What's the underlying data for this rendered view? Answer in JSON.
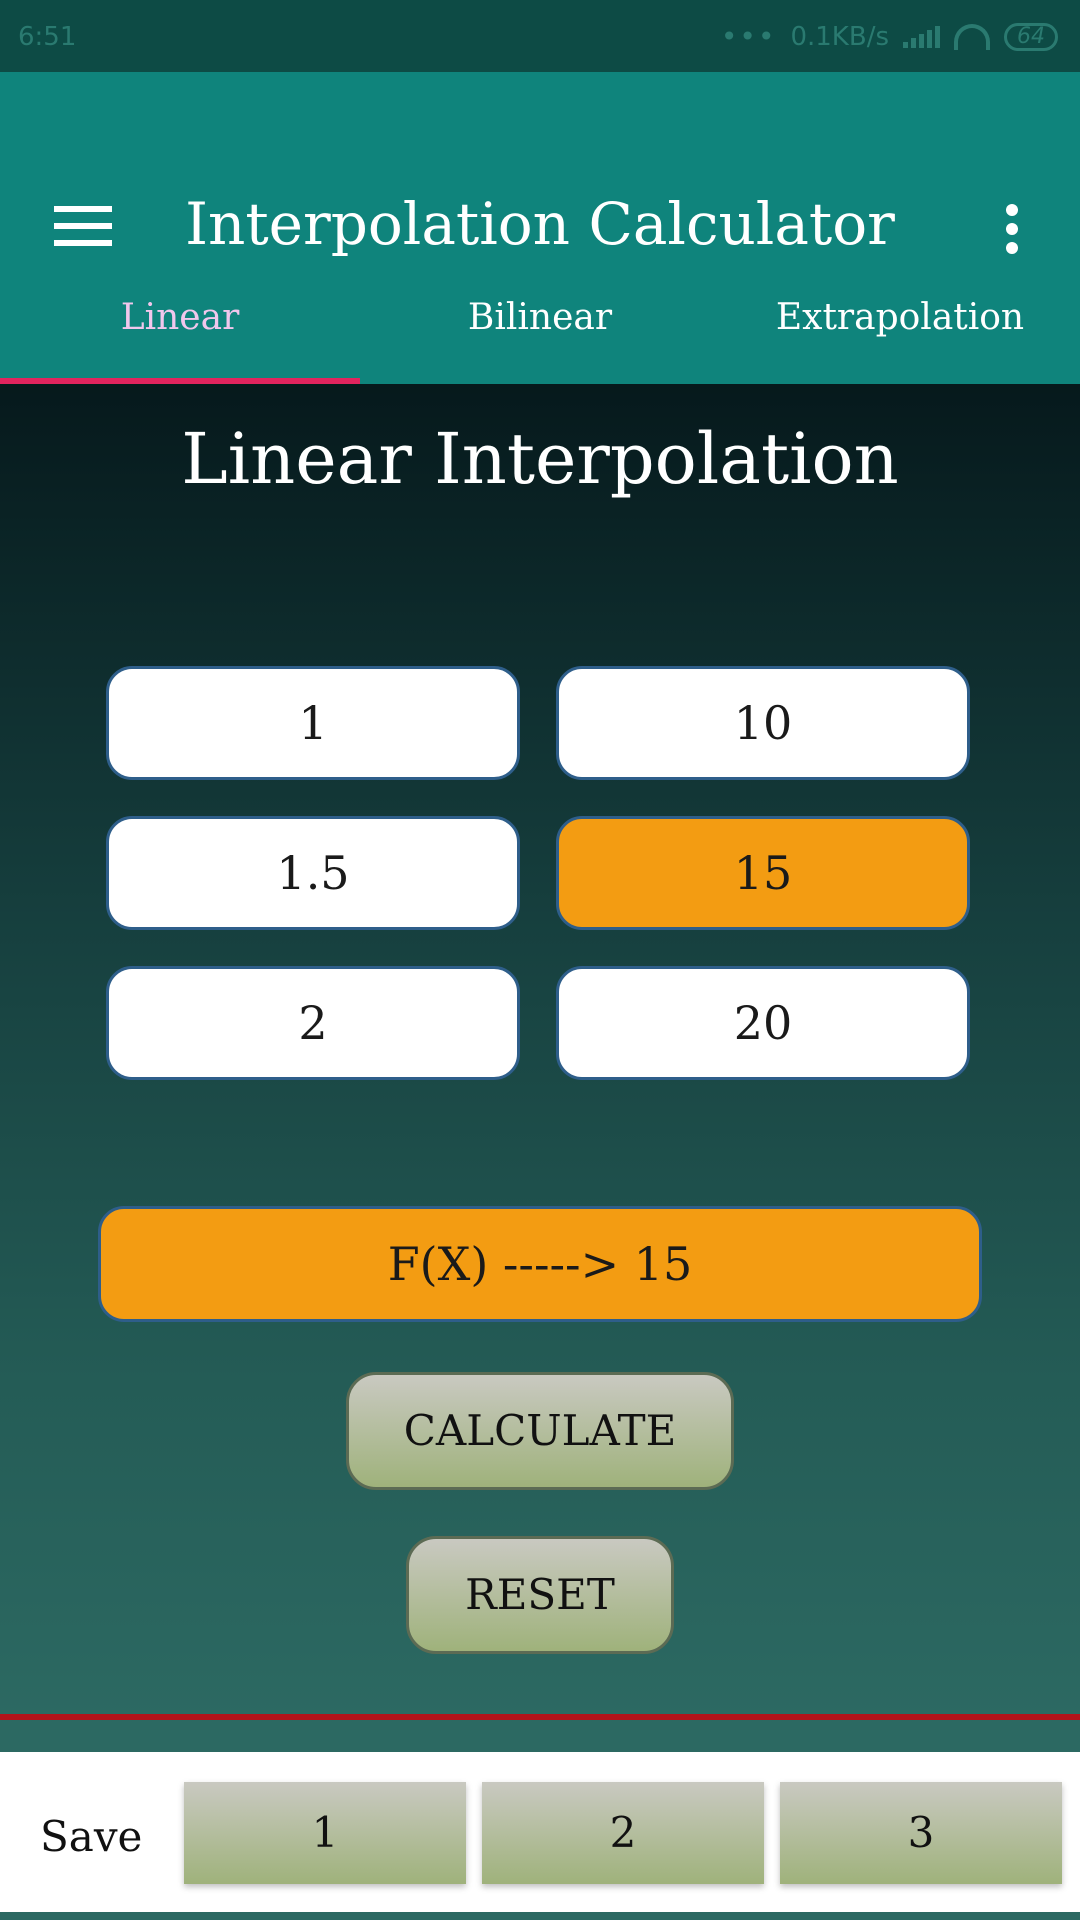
{
  "status_bar": {
    "time": "6:51",
    "network_speed": "0.1KB/s",
    "battery": "64"
  },
  "app_bar": {
    "title": "Interpolation Calculator",
    "menu_icon": "hamburger-menu-icon",
    "more_icon": "more-vertical-icon"
  },
  "tabs": [
    {
      "label": "Linear",
      "active": true
    },
    {
      "label": "Bilinear",
      "active": false
    },
    {
      "label": "Extrapolation",
      "active": false
    }
  ],
  "main": {
    "heading": "Linear Interpolation",
    "x1": "1",
    "y1": "10",
    "x": "1.5",
    "y": "15",
    "x2": "2",
    "y2": "20",
    "result": "F(X) ----->  15",
    "calculate_label": "CALCULATE",
    "reset_label": "RESET"
  },
  "save_bar": {
    "label": "Save",
    "slots": [
      "1",
      "2",
      "3"
    ]
  },
  "colors": {
    "app_bar": "#0f847c",
    "accent": "#e0245e",
    "highlight": "#f39c12",
    "divider": "#b3131b"
  }
}
